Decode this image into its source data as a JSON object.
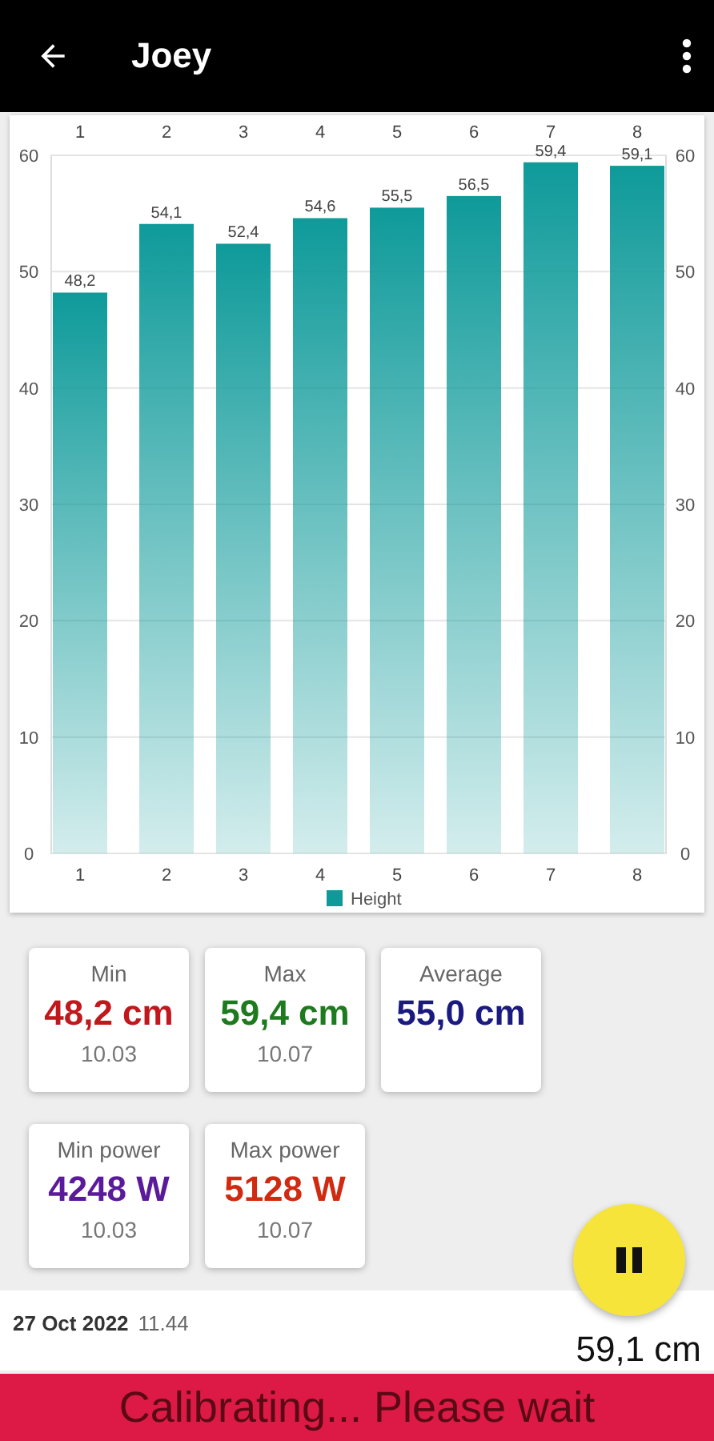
{
  "app_bar": {
    "title": "Joey"
  },
  "chart": {
    "chart_data": {
      "type": "bar",
      "categories": [
        "1",
        "2",
        "3",
        "4",
        "5",
        "6",
        "7",
        "8"
      ],
      "series": [
        {
          "name": "Height",
          "color": "#0f9a9a",
          "values": [
            48.2,
            54.1,
            52.4,
            54.6,
            55.5,
            56.5,
            59.4,
            59.1
          ]
        }
      ],
      "ylim": [
        0,
        60
      ],
      "yticks": [
        0,
        10,
        20,
        30,
        40,
        50,
        60
      ],
      "grid": true,
      "value_labels": [
        "48,2",
        "54,1",
        "52,4",
        "54,6",
        "55,5",
        "56,5",
        "59,4",
        "59,1"
      ]
    },
    "left_axis_labels": [
      "60",
      "50",
      "40",
      "30",
      "20",
      "10",
      "0"
    ]
  },
  "stat_rows": [
    [
      {
        "label": "Min",
        "value": "48,2 cm",
        "color": "#c0181c",
        "date": "10.03"
      },
      {
        "label": "Max",
        "value": "59,4 cm",
        "color": "#1e7a1e",
        "date": "10.07"
      },
      {
        "label": "Average",
        "value": "55,0 cm",
        "color": "#1a1a80"
      }
    ],
    [
      {
        "label": "Min power",
        "value": "4248 W",
        "color": "#5a1a9a",
        "date": "10.03"
      },
      {
        "label": "Max power",
        "value": "5128 W",
        "color": "#d02a10",
        "date": "10.07"
      }
    ]
  ],
  "fab": {
    "paused": true
  },
  "history": [
    {
      "date": "27 Oct 2022",
      "time": "11.44",
      "value": "59,1 cm"
    }
  ],
  "banner": "Calibrating... Please wait"
}
